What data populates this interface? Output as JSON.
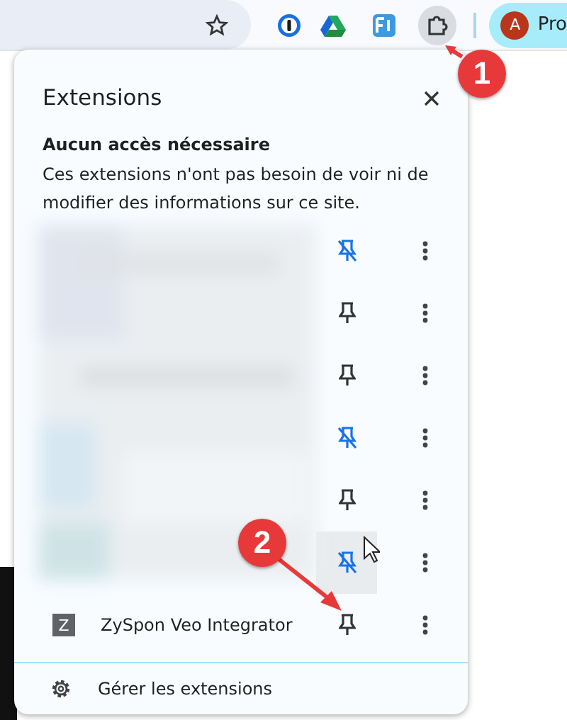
{
  "toolbar": {
    "profile_initial": "A",
    "profile_label": "Pro",
    "extensions_button_active": true
  },
  "popup": {
    "title": "Extensions",
    "section_heading": "Aucun accès nécessaire",
    "section_description": "Ces extensions n'ont pas besoin de voir ni de modifier des informations sur ce site.",
    "extensions": [
      {
        "kind": "picture",
        "pinned": true,
        "hovered": false
      },
      {
        "kind": "picture",
        "pinned": false,
        "hovered": false
      },
      {
        "kind": "picture",
        "pinned": false,
        "hovered": false
      },
      {
        "kind": "picture",
        "pinned": true,
        "hovered": false
      },
      {
        "kind": "picture",
        "pinned": false,
        "hovered": false
      },
      {
        "kind": "picture",
        "pinned": true,
        "hovered": true
      },
      {
        "kind": "named",
        "icon_letter": "Z",
        "name": "ZySpon Veo Integrator",
        "pinned": false,
        "hovered": false
      }
    ],
    "manage_label": "Gérer les extensions"
  },
  "annotations": [
    {
      "number": "1"
    },
    {
      "number": "2"
    }
  ]
}
